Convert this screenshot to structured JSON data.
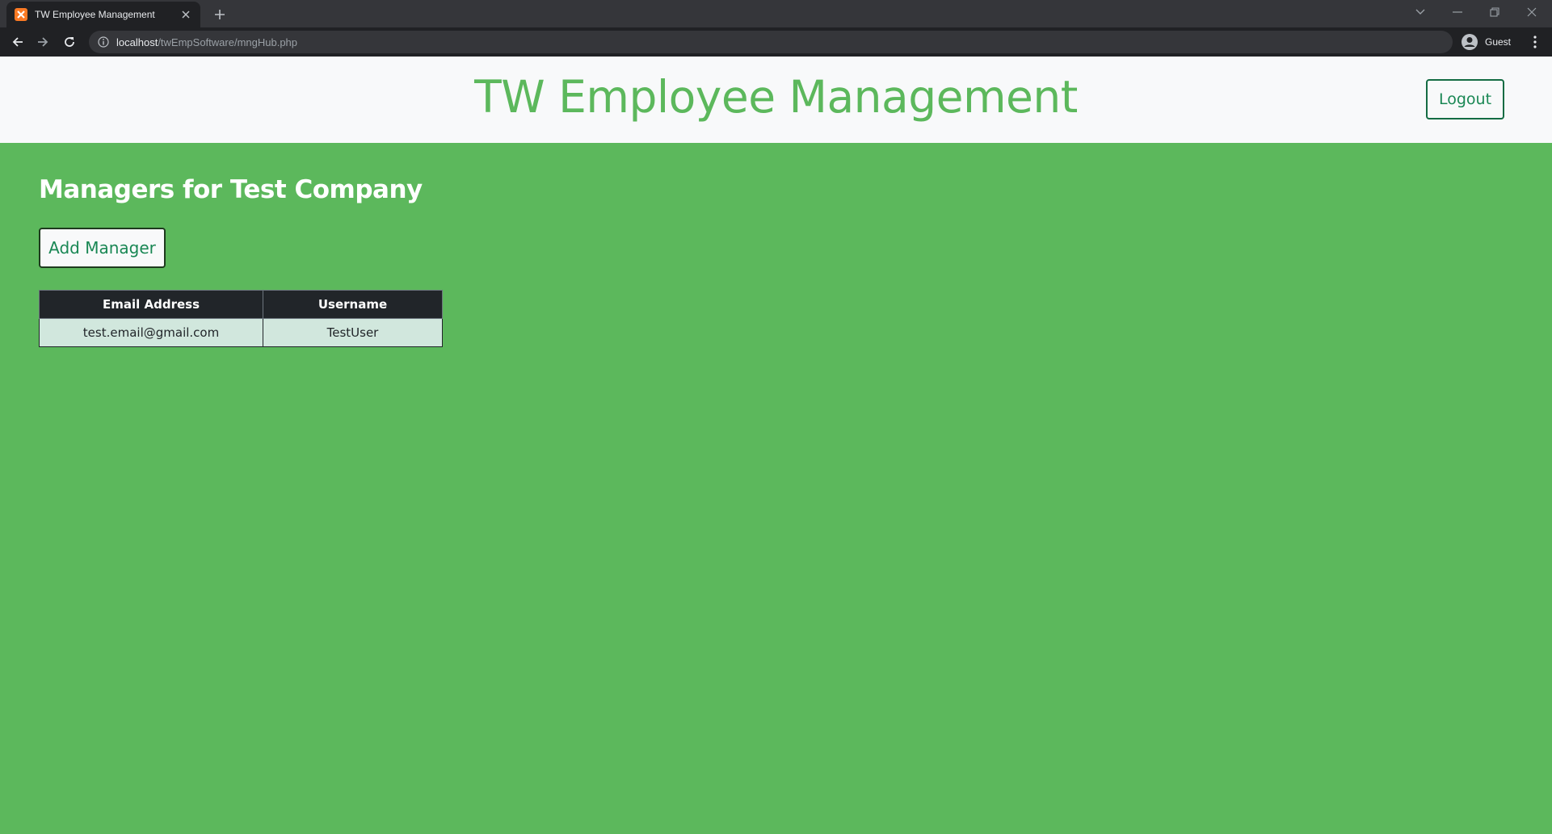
{
  "browser": {
    "tab_title": "TW Employee Management",
    "url_host": "localhost",
    "url_path": "/twEmpSoftware/mngHub.php",
    "profile_label": "Guest"
  },
  "header": {
    "title": "TW Employee Management",
    "logout_label": "Logout"
  },
  "main": {
    "section_title": "Managers for Test Company",
    "add_button_label": "Add Manager",
    "table": {
      "columns": [
        "Email Address",
        "Username"
      ],
      "rows": [
        [
          "test.email@gmail.com",
          "TestUser"
        ]
      ]
    }
  },
  "colors": {
    "accent_green": "#5cb85c",
    "header_bg": "#f8f9fa",
    "button_text": "#198754",
    "table_header_bg": "#212529",
    "table_row_bg": "#d1e7dd"
  },
  "icons": {
    "favicon": "xampp-favicon",
    "tab_close": "close-icon",
    "new_tab": "plus-icon",
    "back": "arrow-left-icon",
    "forward": "arrow-right-icon",
    "reload": "reload-icon",
    "site_info": "info-icon",
    "profile": "account-circle-icon",
    "menu": "kebab-menu-icon"
  }
}
